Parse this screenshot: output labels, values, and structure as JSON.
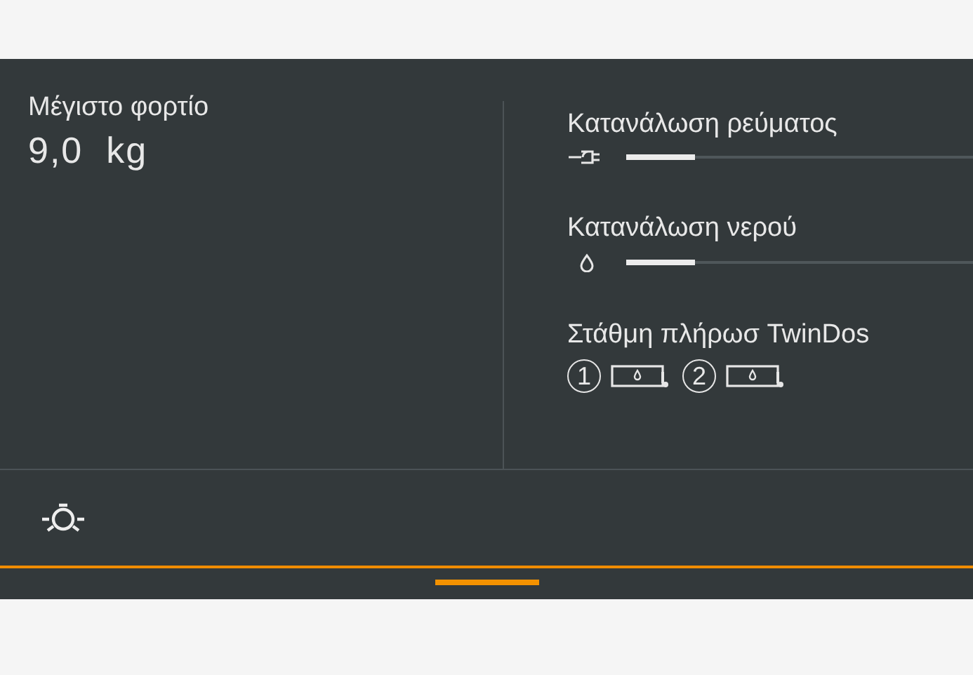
{
  "max_load": {
    "label": "Μέγιστο φορτίο",
    "value": "9,0  kg"
  },
  "consumption": [
    {
      "label": "Κατανάλωση ρεύματος",
      "kind": "power",
      "level": 0.2
    },
    {
      "label": "Κατανάλωση νερού",
      "kind": "water",
      "level": 0.2
    }
  ],
  "twindos": {
    "label": "Στάθμη πλήρωσ TwinDos",
    "containers": [
      {
        "number": "1"
      },
      {
        "number": "2"
      }
    ]
  },
  "bottom_bar": {
    "pages": [
      {
        "selected": true
      }
    ]
  }
}
